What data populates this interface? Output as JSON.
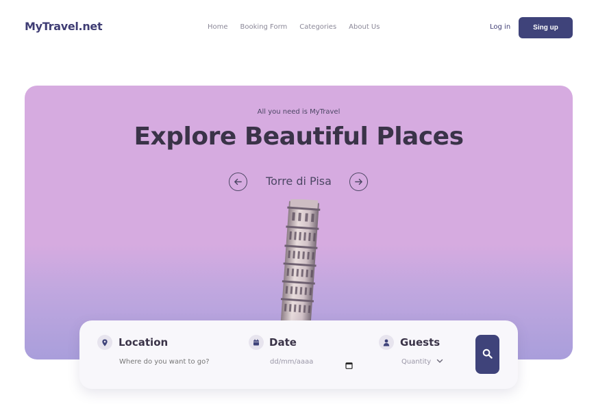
{
  "header": {
    "logo": "MyTravel.net",
    "nav": [
      "Home",
      "Booking Form",
      "Categories",
      "About Us"
    ],
    "login": "Log in",
    "signup": "Sing up"
  },
  "hero": {
    "tagline": "All you need is MyTravel",
    "title": "Explore Beautiful Places",
    "place": "Torre di Pisa"
  },
  "search": {
    "location": {
      "label": "Location",
      "placeholder": "Where do you want to go?"
    },
    "date": {
      "label": "Date",
      "placeholder": "dd/mm/aaaa"
    },
    "guests": {
      "label": "Guests",
      "selected": "Quantity"
    }
  },
  "colors": {
    "brand": "#3f437a",
    "hero_top": "#d6abe0",
    "hero_bottom": "#a99edb"
  },
  "icons": {
    "prev": "arrow-left-icon",
    "next": "arrow-right-icon",
    "location": "map-pin-icon",
    "date": "calendar-icon",
    "guests": "user-icon",
    "search": "search-icon"
  }
}
